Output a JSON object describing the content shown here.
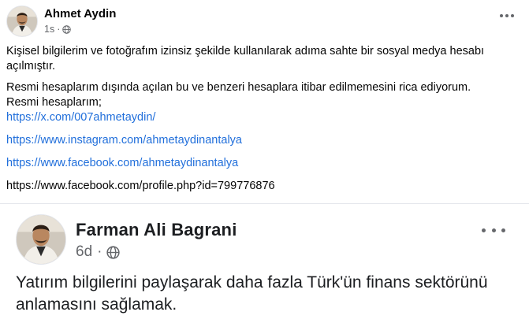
{
  "post1": {
    "author": "Ahmet Aydin",
    "time": "1s",
    "separator": "·",
    "privacy_icon": "globe-icon",
    "more_icon": "more-horizontal-icon",
    "paragraphs": [
      "Kişisel bilgilerim ve fotoğrafım izinsiz şekilde kullanılarak adıma sahte bir sosyal medya hesabı açılmıştır.",
      "Resmi hesaplarım dışında açılan bu ve benzeri hesaplara itibar edilmemesini rica ediyorum.",
      "Resmi hesaplarım;"
    ],
    "links": [
      "https://x.com/007ahmetaydin/",
      "https://www.instagram.com/ahmetaydinantalya",
      "https://www.facebook.com/ahmetaydinantalya",
      "https://www.facebook.com/profile.php?id=799776876"
    ]
  },
  "post2": {
    "author": "Farman Ali Bagrani",
    "time": "6d",
    "separator": "·",
    "privacy_icon": "globe-icon",
    "more_icon": "more-horizontal-icon",
    "text": "Yatırım bilgilerini paylaşarak daha fazla Türk'ün finans sektörünü anlamasını sağlamak."
  },
  "colors": {
    "link": "#216fdb",
    "secondary_text": "#65676b",
    "primary_text": "#050505",
    "divider": "#e4e6eb"
  }
}
